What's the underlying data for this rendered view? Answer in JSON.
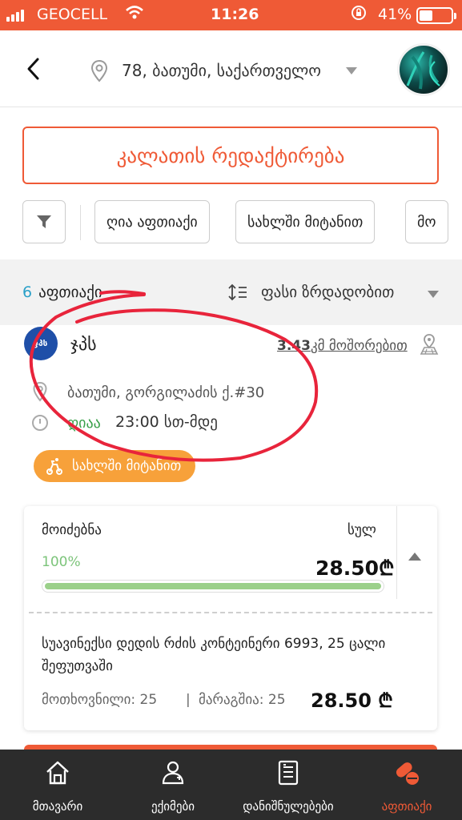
{
  "status_bar": {
    "carrier": "GEOCELL",
    "time": "11:26",
    "battery": "41%"
  },
  "header": {
    "location": "78, ბათუმი, საქართველო"
  },
  "edit_button_label": "კალათის რედაქტირება",
  "filters": [
    "ღია აფთიაქი",
    "სახლში მიტანით",
    "მო"
  ],
  "results": {
    "count": "6",
    "label": "აფთიაქი",
    "sort_label": "ფასი ზრდადობით"
  },
  "pharmacy": {
    "logo_text": "ჯპს",
    "name": "ჯპს",
    "distance_value": "3.43",
    "distance_unit": "კმ მოშორებით",
    "address": "ბათუმი, გორგილაძის ქ.#30",
    "open_status": "ღიაა",
    "hours": "23:00 სთ-მდე",
    "delivery_label": "სახლში მიტანით"
  },
  "availability_card": {
    "available_label": "მოიძებნა",
    "total_label": "სულ",
    "percent": "100%",
    "percent_value": 100,
    "total_price": "28.50₾",
    "product_name": "სუავინექსი დედის რძის კონტეინერი 6993, 25 ცალი შეფუთვაში",
    "requested": "მოთხოვნილი: 25",
    "separator": "|",
    "in_stock": "მარაგშია: 25",
    "item_price": "28.50 ₾"
  },
  "tabs": [
    {
      "label": "მთავარი",
      "icon": "home-icon",
      "active": false
    },
    {
      "label": "ექიმები",
      "icon": "doctor-icon",
      "active": false
    },
    {
      "label": "დანიშნულებები",
      "icon": "prescription-icon",
      "active": false
    },
    {
      "label": "აფთიაქი",
      "icon": "pills-icon",
      "active": true
    }
  ],
  "colors": {
    "accent": "#ef5a36",
    "delivery": "#f7a13a",
    "open": "#3aa14a",
    "progress": "#9bd08a",
    "count": "#2aa0c8"
  }
}
